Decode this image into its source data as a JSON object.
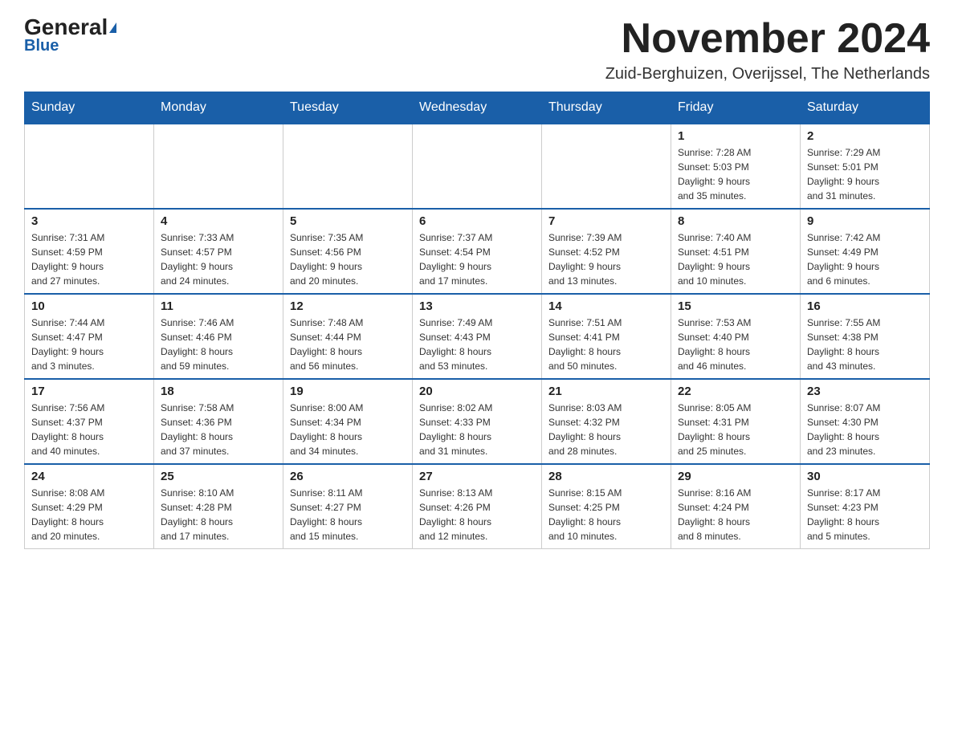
{
  "header": {
    "logo_general": "General",
    "logo_blue": "Blue",
    "month_title": "November 2024",
    "location": "Zuid-Berghuizen, Overijssel, The Netherlands"
  },
  "days_of_week": [
    "Sunday",
    "Monday",
    "Tuesday",
    "Wednesday",
    "Thursday",
    "Friday",
    "Saturday"
  ],
  "weeks": [
    [
      {
        "day": "",
        "info": ""
      },
      {
        "day": "",
        "info": ""
      },
      {
        "day": "",
        "info": ""
      },
      {
        "day": "",
        "info": ""
      },
      {
        "day": "",
        "info": ""
      },
      {
        "day": "1",
        "info": "Sunrise: 7:28 AM\nSunset: 5:03 PM\nDaylight: 9 hours\nand 35 minutes."
      },
      {
        "day": "2",
        "info": "Sunrise: 7:29 AM\nSunset: 5:01 PM\nDaylight: 9 hours\nand 31 minutes."
      }
    ],
    [
      {
        "day": "3",
        "info": "Sunrise: 7:31 AM\nSunset: 4:59 PM\nDaylight: 9 hours\nand 27 minutes."
      },
      {
        "day": "4",
        "info": "Sunrise: 7:33 AM\nSunset: 4:57 PM\nDaylight: 9 hours\nand 24 minutes."
      },
      {
        "day": "5",
        "info": "Sunrise: 7:35 AM\nSunset: 4:56 PM\nDaylight: 9 hours\nand 20 minutes."
      },
      {
        "day": "6",
        "info": "Sunrise: 7:37 AM\nSunset: 4:54 PM\nDaylight: 9 hours\nand 17 minutes."
      },
      {
        "day": "7",
        "info": "Sunrise: 7:39 AM\nSunset: 4:52 PM\nDaylight: 9 hours\nand 13 minutes."
      },
      {
        "day": "8",
        "info": "Sunrise: 7:40 AM\nSunset: 4:51 PM\nDaylight: 9 hours\nand 10 minutes."
      },
      {
        "day": "9",
        "info": "Sunrise: 7:42 AM\nSunset: 4:49 PM\nDaylight: 9 hours\nand 6 minutes."
      }
    ],
    [
      {
        "day": "10",
        "info": "Sunrise: 7:44 AM\nSunset: 4:47 PM\nDaylight: 9 hours\nand 3 minutes."
      },
      {
        "day": "11",
        "info": "Sunrise: 7:46 AM\nSunset: 4:46 PM\nDaylight: 8 hours\nand 59 minutes."
      },
      {
        "day": "12",
        "info": "Sunrise: 7:48 AM\nSunset: 4:44 PM\nDaylight: 8 hours\nand 56 minutes."
      },
      {
        "day": "13",
        "info": "Sunrise: 7:49 AM\nSunset: 4:43 PM\nDaylight: 8 hours\nand 53 minutes."
      },
      {
        "day": "14",
        "info": "Sunrise: 7:51 AM\nSunset: 4:41 PM\nDaylight: 8 hours\nand 50 minutes."
      },
      {
        "day": "15",
        "info": "Sunrise: 7:53 AM\nSunset: 4:40 PM\nDaylight: 8 hours\nand 46 minutes."
      },
      {
        "day": "16",
        "info": "Sunrise: 7:55 AM\nSunset: 4:38 PM\nDaylight: 8 hours\nand 43 minutes."
      }
    ],
    [
      {
        "day": "17",
        "info": "Sunrise: 7:56 AM\nSunset: 4:37 PM\nDaylight: 8 hours\nand 40 minutes."
      },
      {
        "day": "18",
        "info": "Sunrise: 7:58 AM\nSunset: 4:36 PM\nDaylight: 8 hours\nand 37 minutes."
      },
      {
        "day": "19",
        "info": "Sunrise: 8:00 AM\nSunset: 4:34 PM\nDaylight: 8 hours\nand 34 minutes."
      },
      {
        "day": "20",
        "info": "Sunrise: 8:02 AM\nSunset: 4:33 PM\nDaylight: 8 hours\nand 31 minutes."
      },
      {
        "day": "21",
        "info": "Sunrise: 8:03 AM\nSunset: 4:32 PM\nDaylight: 8 hours\nand 28 minutes."
      },
      {
        "day": "22",
        "info": "Sunrise: 8:05 AM\nSunset: 4:31 PM\nDaylight: 8 hours\nand 25 minutes."
      },
      {
        "day": "23",
        "info": "Sunrise: 8:07 AM\nSunset: 4:30 PM\nDaylight: 8 hours\nand 23 minutes."
      }
    ],
    [
      {
        "day": "24",
        "info": "Sunrise: 8:08 AM\nSunset: 4:29 PM\nDaylight: 8 hours\nand 20 minutes."
      },
      {
        "day": "25",
        "info": "Sunrise: 8:10 AM\nSunset: 4:28 PM\nDaylight: 8 hours\nand 17 minutes."
      },
      {
        "day": "26",
        "info": "Sunrise: 8:11 AM\nSunset: 4:27 PM\nDaylight: 8 hours\nand 15 minutes."
      },
      {
        "day": "27",
        "info": "Sunrise: 8:13 AM\nSunset: 4:26 PM\nDaylight: 8 hours\nand 12 minutes."
      },
      {
        "day": "28",
        "info": "Sunrise: 8:15 AM\nSunset: 4:25 PM\nDaylight: 8 hours\nand 10 minutes."
      },
      {
        "day": "29",
        "info": "Sunrise: 8:16 AM\nSunset: 4:24 PM\nDaylight: 8 hours\nand 8 minutes."
      },
      {
        "day": "30",
        "info": "Sunrise: 8:17 AM\nSunset: 4:23 PM\nDaylight: 8 hours\nand 5 minutes."
      }
    ]
  ]
}
